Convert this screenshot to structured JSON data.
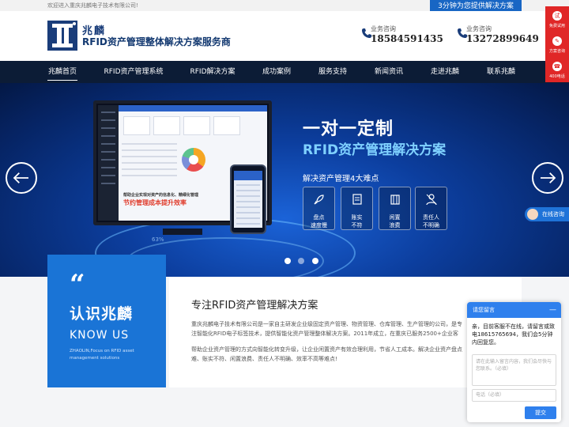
{
  "topbar": {
    "welcome": "欢迎进入重庆兆麟电子技术有限公司!",
    "banner_tag": "3分钟为您提供解决方案"
  },
  "header": {
    "logo_name": "兆麟",
    "slogan": "RFID资产管理整体解决方案服务商",
    "phones": [
      {
        "label": "业务咨询",
        "number": "18584591435"
      },
      {
        "label": "业务咨询",
        "number": "13272899649"
      }
    ]
  },
  "nav": {
    "items": [
      {
        "label": "兆麟首页"
      },
      {
        "label": "RFID资产管理系统"
      },
      {
        "label": "RFID解决方案"
      },
      {
        "label": "成功案例"
      },
      {
        "label": "服务支持"
      },
      {
        "label": "新闻资讯"
      },
      {
        "label": "走进兆麟"
      },
      {
        "label": "联系兆麟"
      }
    ]
  },
  "hero": {
    "headline": "一对一定制",
    "subheadline": "RFID资产管理解决方案",
    "pain_title": "解决资产管理4大难点",
    "screen_promo_line1": "帮助企业实现对资产的信息化、精细化管理",
    "screen_promo_line2": "节约管理成本提升效率",
    "screen_percent": "63%",
    "pain_points": [
      {
        "line1": "盘点",
        "line2": "速度慢",
        "icon": "rocket-icon"
      },
      {
        "line1": "账实",
        "line2": "不符",
        "icon": "ledger-icon"
      },
      {
        "line1": "闲置",
        "line2": "浪费",
        "icon": "building-icon"
      },
      {
        "line1": "责任人",
        "line2": "不明确",
        "icon": "person-icon"
      }
    ],
    "carousel_active": 1,
    "carousel_count": 3
  },
  "side_tools": [
    {
      "label": "免费试用",
      "glyph": "试"
    },
    {
      "label": "方案咨询",
      "glyph": "✎"
    },
    {
      "label": "400电话",
      "glyph": "☎"
    }
  ],
  "online_button": "在线咨询",
  "about": {
    "quote_mark": "“",
    "title_zh": "认识兆麟",
    "title_en": "KNOW US",
    "subtitle_en": "ZHAOLIN,Focus on RFID asset management solutions",
    "section_title": "专注RFID资产管理解决方案",
    "paragraph1": "重庆兆麟电子技术有限公司是一家自主研发企业级固定资产管理、物资管理、仓库管理、生产管理的公司，是专注智能化RFID电子标签技术，提供智能化资产管理整体解决方案。2011年成立，在重庆已服务2500+企业客户。",
    "paragraph2": "帮助企业资产管理的方式向智能化转变升级，让企业闲置资产有效合理利用，节省人工成本。解决企业资产盘点难、账实不符、闲置浪费、责任人不明确、效率不高等难点!"
  },
  "chat": {
    "header": "请您留言",
    "minimize": "—",
    "message": "亲，目前客服不在线，请留言或致电18615765694，我们会5分钟内回复您。",
    "textarea_placeholder": "请在此输入留言内容，我们会尽快与您联系。（必填）",
    "phone_placeholder": "电话（必填）",
    "submit": "提交"
  },
  "colors": {
    "brand_blue": "#1a74d6",
    "nav_dark": "#0c1c36",
    "tool_red": "#e02727",
    "chat_blue": "#2f80ed"
  }
}
